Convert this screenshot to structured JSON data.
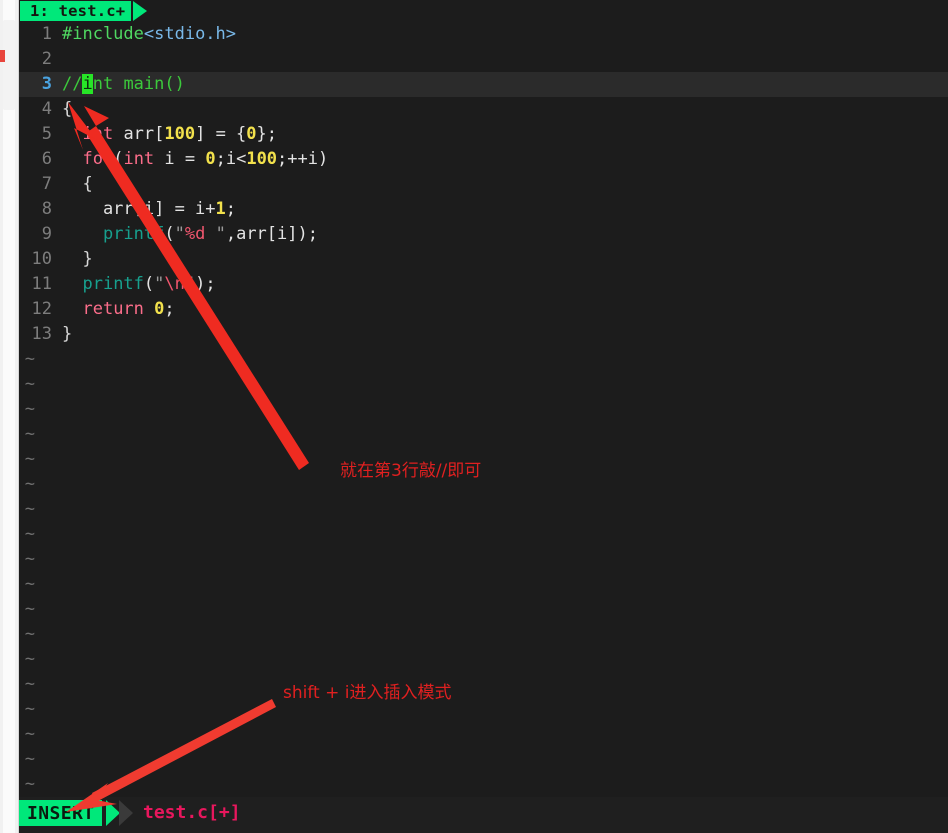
{
  "window": {
    "background_color": "#1c1c1c",
    "accent_green": "#00e87a",
    "annotation_color": "#e02020"
  },
  "tabline": {
    "tab_label": "1: test.c+"
  },
  "editor": {
    "lines": [
      {
        "number": "1",
        "current": false,
        "tokens": [
          {
            "text": "#include",
            "class": "s-pre"
          },
          {
            "text": "<stdio.h>",
            "class": "s-inc"
          }
        ]
      },
      {
        "number": "2",
        "current": false,
        "tokens": []
      },
      {
        "number": "3",
        "current": true,
        "tokens": [
          {
            "text": "//",
            "class": "s-cmt"
          },
          {
            "text": "i",
            "class": "cursor"
          },
          {
            "text": "nt main()",
            "class": "s-cmt"
          }
        ]
      },
      {
        "number": "4",
        "current": false,
        "tokens": [
          {
            "text": "{",
            "class": "s-punct"
          }
        ]
      },
      {
        "number": "5",
        "current": false,
        "tokens": [
          {
            "text": "  ",
            "class": "s-punct"
          },
          {
            "text": "int",
            "class": "s-kw"
          },
          {
            "text": " arr[",
            "class": "s-id"
          },
          {
            "text": "100",
            "class": "s-num"
          },
          {
            "text": "] = {",
            "class": "s-id"
          },
          {
            "text": "0",
            "class": "s-num"
          },
          {
            "text": "};",
            "class": "s-id"
          }
        ]
      },
      {
        "number": "6",
        "current": false,
        "tokens": [
          {
            "text": "  ",
            "class": "s-punct"
          },
          {
            "text": "for",
            "class": "s-kw"
          },
          {
            "text": "(",
            "class": "s-id"
          },
          {
            "text": "int",
            "class": "s-kw"
          },
          {
            "text": " i = ",
            "class": "s-id"
          },
          {
            "text": "0",
            "class": "s-num"
          },
          {
            "text": ";i<",
            "class": "s-id"
          },
          {
            "text": "100",
            "class": "s-num"
          },
          {
            "text": ";++i)",
            "class": "s-id"
          }
        ]
      },
      {
        "number": "7",
        "current": false,
        "tokens": [
          {
            "text": "  {",
            "class": "s-punct"
          }
        ]
      },
      {
        "number": "8",
        "current": false,
        "tokens": [
          {
            "text": "    arr[i] = i+",
            "class": "s-id"
          },
          {
            "text": "1",
            "class": "s-num"
          },
          {
            "text": ";",
            "class": "s-id"
          }
        ]
      },
      {
        "number": "9",
        "current": false,
        "tokens": [
          {
            "text": "    ",
            "class": "s-punct"
          },
          {
            "text": "printf",
            "class": "s-fn"
          },
          {
            "text": "(",
            "class": "s-id"
          },
          {
            "text": "\"",
            "class": "s-str"
          },
          {
            "text": "%d",
            "class": "s-fmt"
          },
          {
            "text": " \"",
            "class": "s-str"
          },
          {
            "text": ",arr[i]);",
            "class": "s-id"
          }
        ]
      },
      {
        "number": "10",
        "current": false,
        "tokens": [
          {
            "text": "  }",
            "class": "s-punct"
          }
        ]
      },
      {
        "number": "11",
        "current": false,
        "tokens": [
          {
            "text": "  ",
            "class": "s-punct"
          },
          {
            "text": "printf",
            "class": "s-fn"
          },
          {
            "text": "(",
            "class": "s-id"
          },
          {
            "text": "\"",
            "class": "s-str"
          },
          {
            "text": "\\n",
            "class": "s-fmt"
          },
          {
            "text": "\"",
            "class": "s-str"
          },
          {
            "text": ");",
            "class": "s-id"
          }
        ]
      },
      {
        "number": "12",
        "current": false,
        "tokens": [
          {
            "text": "  ",
            "class": "s-punct"
          },
          {
            "text": "return",
            "class": "s-kw"
          },
          {
            "text": " ",
            "class": "s-id"
          },
          {
            "text": "0",
            "class": "s-num"
          },
          {
            "text": ";",
            "class": "s-id"
          }
        ]
      },
      {
        "number": "13",
        "current": false,
        "tokens": [
          {
            "text": "}",
            "class": "s-punct"
          }
        ]
      }
    ],
    "filler_marker": "~",
    "filler_count": 18
  },
  "statusline": {
    "mode": "INSERT",
    "filename": "test.c[+]"
  },
  "annotations": [
    {
      "id": "annot-line3",
      "text": "就在第3行敲//即可"
    },
    {
      "id": "annot-insert",
      "text": "shift + i进入插入模式"
    }
  ]
}
